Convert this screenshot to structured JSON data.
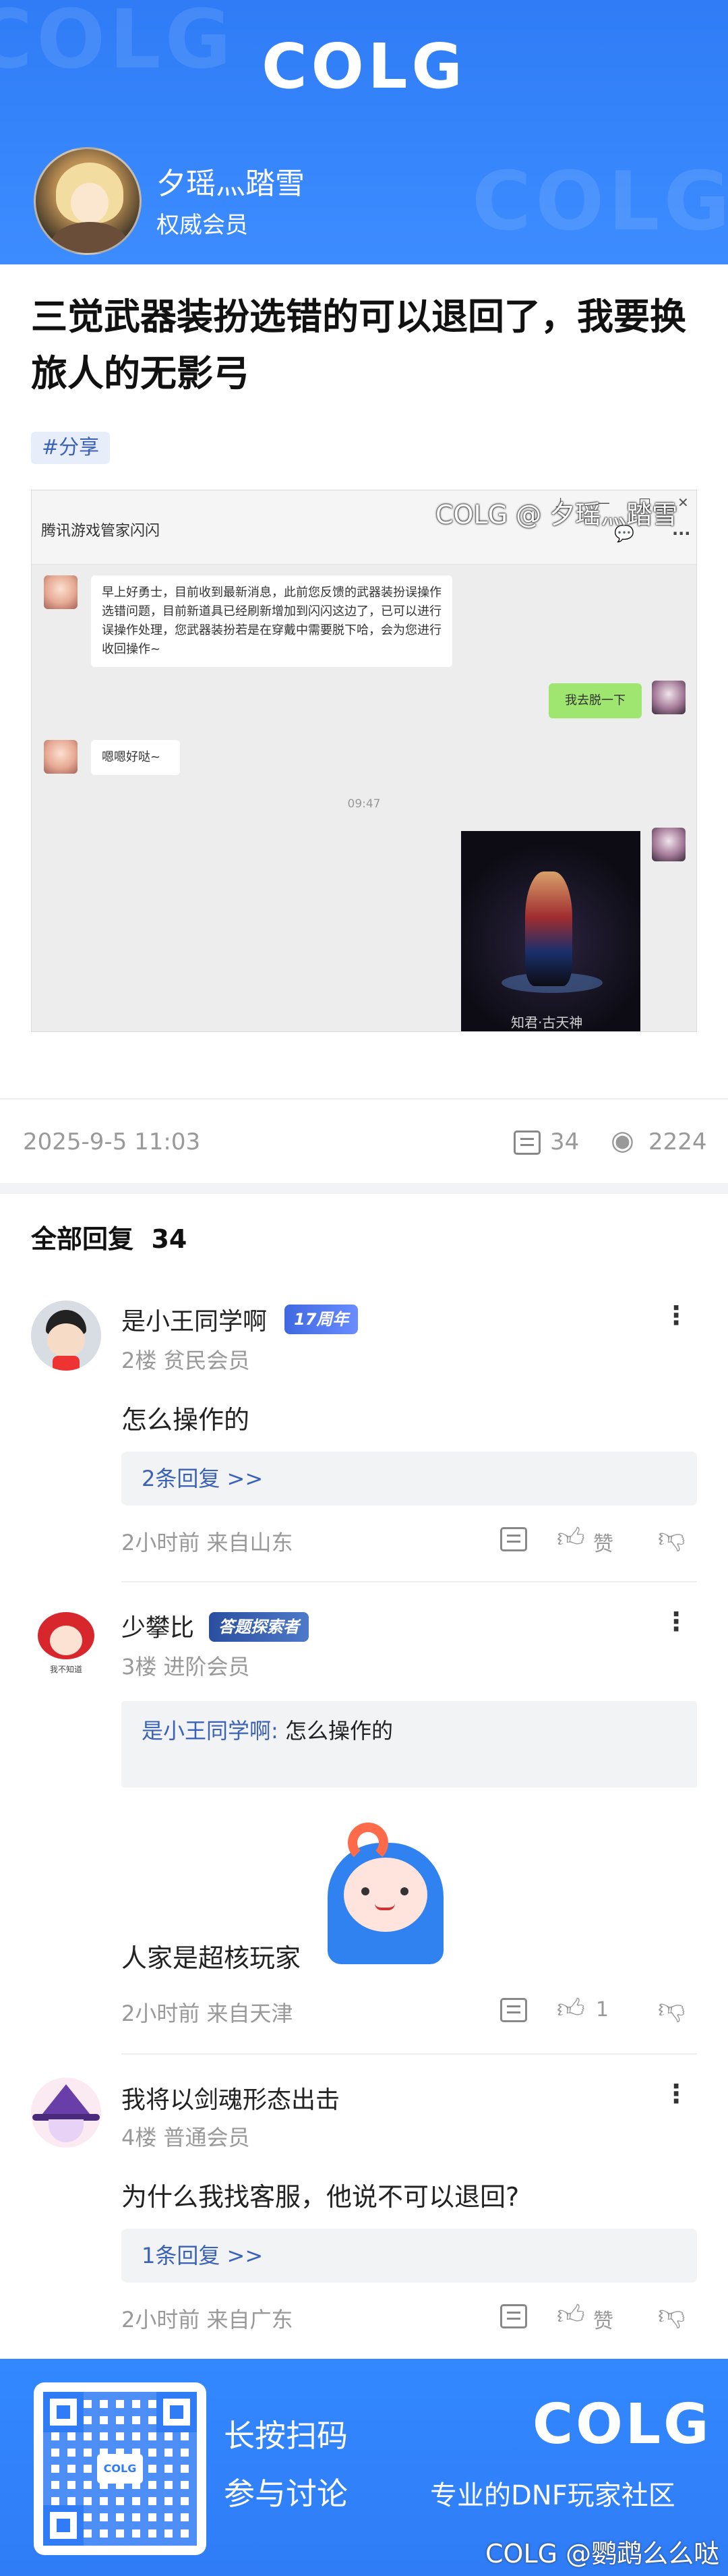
{
  "header": {
    "logo": "COLG",
    "username": "夕瑶灬踏雪",
    "user_title": "权威会员"
  },
  "post": {
    "title": "三觉武器装扮选错的可以退回了，我要换旅人的无影弓",
    "tag": "#分享",
    "date": "2025-9-5 11:03",
    "comment_count": "34",
    "view_count": "2224"
  },
  "screenshot": {
    "window_title": "腾讯游戏管家闪闪",
    "window_controls": [
      "⊥",
      "—",
      "□",
      "✕"
    ],
    "msg1": "早上好勇士，目前收到最新消息，此前您反馈的武器装扮误操作选错问题，目前新道具已经刷新增加到闪闪这边了，已可以进行误操作处理，您武器装扮若是在穿戴中需要脱下哈，会为您进行收回操作~",
    "msg2": "我去脱一下",
    "msg3": "嗯嗯好哒~",
    "time": "09:47",
    "image_caption": "知君·古天神",
    "watermark": "COLG @ 夕瑶灬踏雪"
  },
  "replies": {
    "label": "全部回复",
    "count": "34"
  },
  "comments": [
    {
      "name": "是小王同学啊",
      "badge": "17周年",
      "level": "2楼 贫民会员",
      "text": "怎么操作的",
      "reply_link": "2条回复 >>",
      "foot": "2小时前 来自山东",
      "like": "赞"
    },
    {
      "name": "少攀比",
      "badge": "答题探索者",
      "level": "3楼 进阶会员",
      "quote_name": "是小王同学啊:",
      "quote_text": "怎么操作的",
      "text": "人家是超核玩家",
      "foot": "2小时前 来自天津",
      "like": "1"
    },
    {
      "name": "我将以剑魂形态出击",
      "level": "4楼 普通会员",
      "text": "为什么我找客服，他说不可以退回?",
      "reply_link": "1条回复 >>",
      "foot": "2小时前 来自广东",
      "like": "赞"
    }
  ],
  "footer": {
    "cta1": "长按扫码",
    "cta2": "参与讨论",
    "logo": "COLG",
    "slogan": "专业的DNF玩家社区",
    "watermark": "COLG @鹦鹉么么哒",
    "qr_center": "COLG"
  },
  "colors": {
    "brand": "#2f7cf6",
    "link": "#3a62b8"
  }
}
